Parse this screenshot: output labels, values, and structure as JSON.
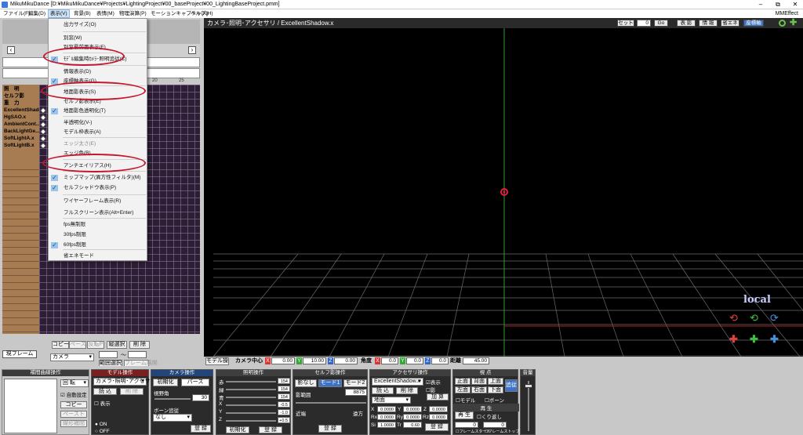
{
  "window": {
    "title": "MikuMikuDance [D:¥MikuMikuDance¥Projects¥LightingProject¥00_baseProject¥00_LightingBaseProject.pmm]",
    "controls": [
      "–",
      "⧉",
      "✕"
    ]
  },
  "menu": {
    "items": [
      "ファイル(F)",
      "編集(D)",
      "表示(V)",
      "背景(B)",
      "表情(M)",
      "物理演算(P)",
      "モーションキャプチャ(K)",
      "ヘルプ(H)"
    ],
    "right": "MMEffect"
  },
  "view_menu": {
    "items": [
      {
        "label": "出力サイズ(O)",
        "checked": false,
        "disabled": false
      },
      {
        "label": "別窓(W)",
        "checked": false,
        "disabled": false
      },
      {
        "label": "別窓最前面表示(F)",
        "checked": false,
        "disabled": false
      },
      {
        "label": "ﾓﾃﾞﾙ編集時ｶﾒﾗ･照明追従(C)",
        "checked": true,
        "disabled": false
      },
      {
        "label": "情報表示(D)",
        "checked": false,
        "disabled": false
      },
      {
        "label": "座標軸表示(G)",
        "checked": true,
        "disabled": false
      },
      {
        "label": "地面影表示(S)",
        "checked": false,
        "disabled": false
      },
      {
        "label": "セルフ影表示(E)",
        "checked": false,
        "disabled": false
      },
      {
        "label": "地面影色透明化(T)",
        "checked": true,
        "disabled": false
      },
      {
        "label": "半透明化(V-)",
        "checked": false,
        "disabled": false
      },
      {
        "label": "モデル枠表示(A)",
        "checked": false,
        "disabled": false
      },
      {
        "label": "エッジ太さ(E)",
        "checked": false,
        "disabled": true
      },
      {
        "label": "エッジ色(B)",
        "checked": false,
        "disabled": false
      },
      {
        "label": "アンチエイリアス(H)",
        "checked": false,
        "disabled": false
      },
      {
        "label": "ミップマップ(異方性フィルタ)(M)",
        "checked": true,
        "disabled": false
      },
      {
        "label": "セルフシャドウ表示(P)",
        "checked": true,
        "disabled": false
      },
      {
        "label": "ワイヤーフレーム表示(R)",
        "checked": false,
        "disabled": false
      },
      {
        "label": "フルスクリーン表示(Alt+Enter)",
        "checked": false,
        "disabled": false
      },
      {
        "label": "fps無制限",
        "checked": false,
        "disabled": false
      },
      {
        "label": "30fps制限",
        "checked": false,
        "disabled": false
      },
      {
        "label": "60fps制限",
        "checked": true,
        "disabled": false
      },
      {
        "label": "省エネモード",
        "checked": false,
        "disabled": false
      }
    ]
  },
  "timeline": {
    "ruler": [
      "20",
      "25"
    ],
    "tracks": [
      "照　明",
      "セルフ影",
      "重　力",
      "ExcellentShadow.x",
      "HgSAO.x",
      "AmbientCont...",
      "BackLightGe...",
      "SoftLightA.x",
      "SoftLightB.x"
    ],
    "current_frame_label": "現フレーム",
    "buttons": {
      "copy": "コピー",
      "paste": "ペースト",
      "invert": "反転P",
      "vert_select": "縦選択",
      "delete": "削 除",
      "range_select": "範囲選択",
      "expand": "フレーム展開"
    },
    "target": "カメラ",
    "tilde": "〜"
  },
  "viewport": {
    "title": "カメラ･照明･アクセサリ / ExcellentShadow.x",
    "set_label": "セット",
    "frame_value": "0",
    "go_label": "Go",
    "buttons": [
      "表 影",
      "情 報",
      "省エネ",
      "座標軸"
    ],
    "local_label": "local",
    "bottom": {
      "mode_label": "モデル操",
      "camera_center": "カメラ中心",
      "x": "0.00",
      "y": "10.00",
      "z": "0.00",
      "angle_label": "角度",
      "ax": "0.0",
      "ay": "0.0",
      "az": "0.0",
      "distance_label": "距離",
      "distance": "45.00"
    }
  },
  "panels": {
    "interp": {
      "title": "補間曲線操作",
      "rotate": "回 転",
      "auto": "自動設定",
      "copy": "コピー",
      "paste": "ペースト",
      "linear": "線形補間"
    },
    "model": {
      "title": "モデル操作",
      "target": "カメラ･照明･アクセサリ",
      "load": "読 込",
      "delete": "削 除",
      "display": "表示",
      "on": "ON",
      "off": "OFF",
      "bone_state": "ボーン追従",
      "none": "なし",
      "register": "登 録"
    },
    "camera": {
      "title": "カメラ操作",
      "init": "初期化",
      "perspective": "パース",
      "fov_label": "視野角",
      "fov": "30",
      "follow_label": "ボーン追従",
      "register": "登 録",
      "follow_value": "なし"
    },
    "light": {
      "title": "照明操作",
      "labels": [
        "赤",
        "緑",
        "青",
        "X",
        "Y",
        "Z"
      ],
      "values": [
        "154",
        "154",
        "154",
        "-0.5",
        "-1.0",
        "+0.5"
      ],
      "init": "初期化",
      "register": "登 録"
    },
    "self_shadow": {
      "title": "セルフ影操作",
      "none": "影なし",
      "mode1": "モード1",
      "mode2": "モード2",
      "range_label": "影範囲",
      "range": "8875",
      "near": "近端",
      "far": "遠方",
      "register": "登 録"
    },
    "accessory": {
      "title": "アクセサリ操作",
      "name": "ExcellentShadow.x",
      "display": "表示",
      "shadow": "影",
      "target": "地面",
      "load": "読 込",
      "delete": "削 除",
      "add": "加 算",
      "X": "0.0000",
      "Y": "0.0000",
      "Z": "0.0000",
      "Rx": "0.0000",
      "Ry": "0.0000",
      "Rz": "0.0000",
      "Si": "1.0000",
      "Tr": "0.60",
      "register": "登 録"
    },
    "view": {
      "title": "視 点",
      "front": "正面",
      "back": "背面",
      "top": "上面",
      "left": "左面",
      "right": "右面",
      "bottom": "下面",
      "track": "追従",
      "model": "モデル",
      "bone": "ボーン",
      "play_title": "再 生",
      "play": "再 生",
      "repeat": "くり返し",
      "from": "0",
      "to": "0",
      "frame_start": "フレームスタート",
      "frame_stop": "フレームストップ",
      "volume": "音量"
    }
  }
}
